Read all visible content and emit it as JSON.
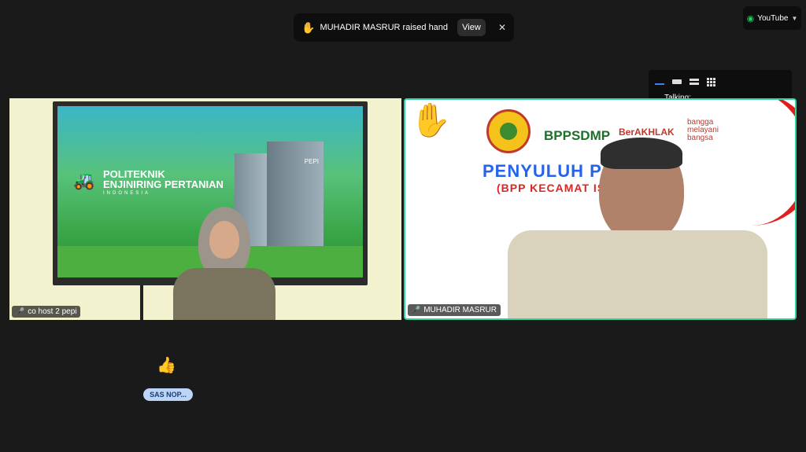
{
  "notification": {
    "icon": "raised-hand-icon",
    "message": "MUHADIR MASRUR raised hand",
    "view_label": "View",
    "close_glyph": "✕"
  },
  "youtube": {
    "label": "YouTube"
  },
  "view_switcher": {
    "talking_label": "Talking:"
  },
  "tiles": [
    {
      "name": "co host 2 pepi",
      "screen_title_1": "POLITEKNIK",
      "screen_title_2": "ENJINIRING PERTANIAN",
      "screen_sub": "INDONESIA",
      "screen_logo": "PEPI"
    },
    {
      "name": "MUHADIR MASRUR",
      "raised_hand": "✋",
      "logo_bppsdmp": "BPPSDMP",
      "logo_berakhlak": "BerAKHLAK",
      "logo_bangga": "bangga",
      "logo_melayani": "melayani",
      "logo_bangsa": "bangsa",
      "banner_line1": "PENYULUH P     AN",
      "banner_line2": "(BPP KECAMAT       IS)"
    }
  ],
  "reaction": {
    "emoji": "👍",
    "name": "SAS NOP..."
  },
  "colors": {
    "active_border": "#34d399",
    "background": "#1a1a1a"
  }
}
